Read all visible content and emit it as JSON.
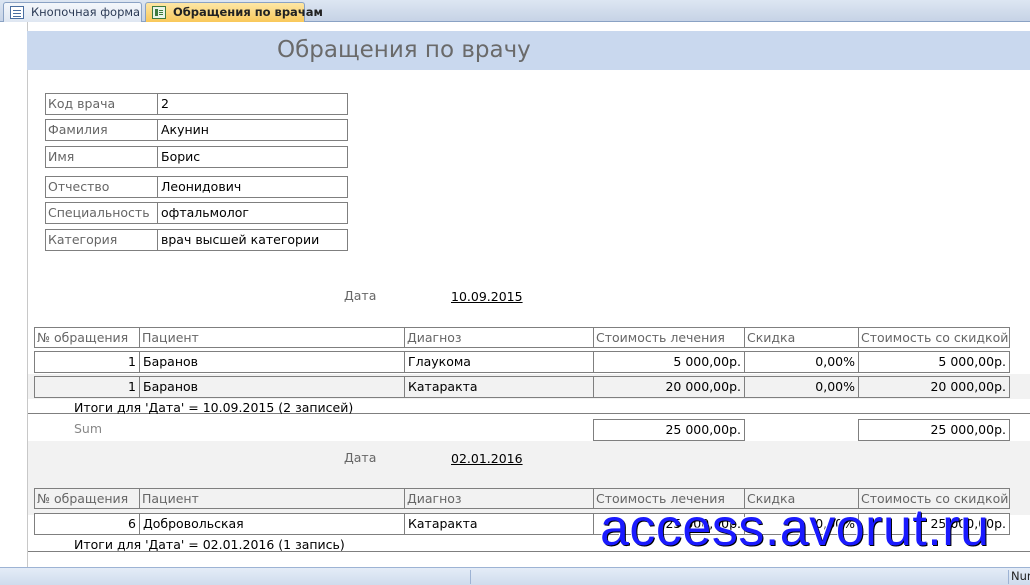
{
  "tabs": [
    {
      "label": "Кнопочная форма",
      "icon": "form-icon",
      "active": false
    },
    {
      "label": "Обращения по врачам",
      "icon": "report-icon",
      "active": true
    }
  ],
  "report": {
    "title": "Обращения по врачу",
    "doctor": [
      {
        "label": "Код врача",
        "value": "2"
      },
      {
        "label": "Фамилия",
        "value": "Акунин"
      },
      {
        "label": "Имя",
        "value": "Борис"
      },
      {
        "label": "Отчество",
        "value": "Леонидович"
      },
      {
        "label": "Специальность",
        "value": "офтальмолог"
      },
      {
        "label": "Категория",
        "value": "врач высшей категории"
      }
    ],
    "date_label": "Дата",
    "columns": [
      "№ обращения",
      "Пациент",
      "Диагноз",
      "Стоимость лечения",
      "Скидка",
      "Стоимость со скидкой"
    ],
    "sum_label": "Sum",
    "groups": [
      {
        "date": "10.09.2015",
        "rows": [
          [
            "1",
            "Баранов",
            "Глаукома",
            "5 000,00р.",
            "0,00%",
            "5 000,00р."
          ],
          [
            "1",
            "Баранов",
            "Катаракта",
            "20 000,00р.",
            "0,00%",
            "20 000,00р."
          ]
        ],
        "summary": "Итоги для 'Дата' =  10.09.2015 (2 записей)",
        "sum_cost": "25 000,00р.",
        "sum_discounted": "25 000,00р."
      },
      {
        "date": "02.01.2016",
        "rows": [
          [
            "6",
            "Добровольская",
            "Катаракта",
            "25 000,00р.",
            "0,00%",
            "25 000,00р."
          ]
        ],
        "summary": "Итоги для 'Дата' =  02.01.2016 (1 запись)"
      }
    ]
  },
  "status": {
    "num": "Num"
  },
  "watermark": "access.avorut.ru",
  "colors": {
    "header_band": "#c9d8ee",
    "active_tab": "#f9c85a",
    "watermark": "#1a1aff"
  }
}
